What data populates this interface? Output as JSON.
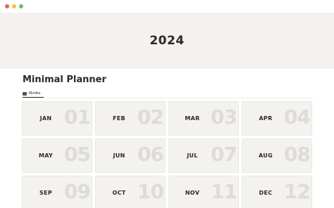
{
  "cover": {
    "title": "2024"
  },
  "page": {
    "title": "Minimal Planner"
  },
  "view_tab": {
    "label": "Months",
    "icon": "table-icon"
  },
  "months": [
    {
      "name": "JAN",
      "number": "01"
    },
    {
      "name": "FEB",
      "number": "02"
    },
    {
      "name": "MAR",
      "number": "03"
    },
    {
      "name": "APR",
      "number": "04"
    },
    {
      "name": "MAY",
      "number": "05"
    },
    {
      "name": "JUN",
      "number": "06"
    },
    {
      "name": "JUL",
      "number": "07"
    },
    {
      "name": "AUG",
      "number": "08"
    },
    {
      "name": "SEP",
      "number": "09"
    },
    {
      "name": "OCT",
      "number": "10"
    },
    {
      "name": "NOV",
      "number": "11"
    },
    {
      "name": "DEC",
      "number": "12"
    }
  ],
  "colors": {
    "cover_bg": "#f3f2ef",
    "card_bg": "#f3f2ef",
    "text": "#2b2a28",
    "watermark_number": "#dddcd8"
  }
}
